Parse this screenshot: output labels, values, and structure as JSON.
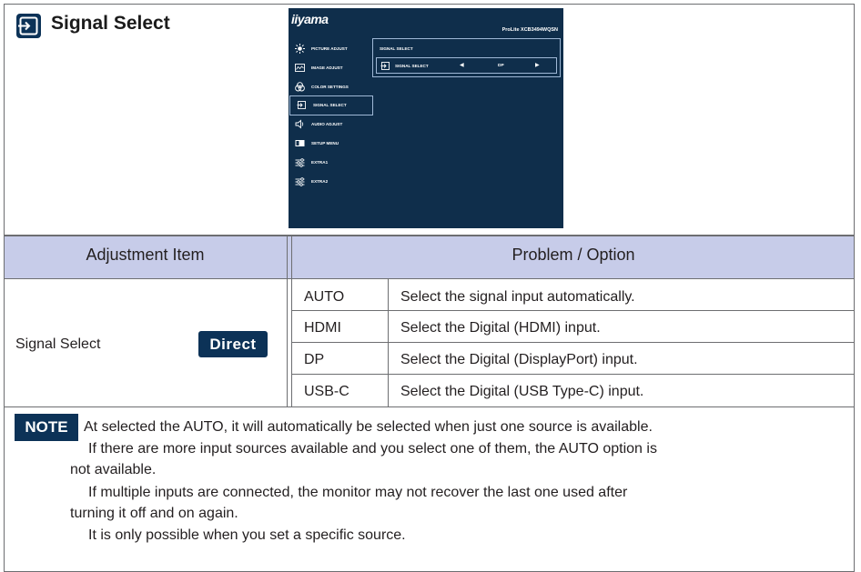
{
  "header": {
    "title": "Signal Select",
    "icon": "signal-input-icon"
  },
  "osd": {
    "logo": "iiyama",
    "model": "ProLite XCB3494WQSN",
    "menu": [
      {
        "label": "PICTURE ADJUST",
        "icon": "sun-icon",
        "selected": false
      },
      {
        "label": "IMAGE ADJUST",
        "icon": "image-adjust-icon",
        "selected": false
      },
      {
        "label": "COLOR SETTINGS",
        "icon": "color-settings-icon",
        "selected": false
      },
      {
        "label": "SIGNAL SELECT",
        "icon": "signal-input-icon",
        "selected": true
      },
      {
        "label": "AUDIO ADJUST",
        "icon": "speaker-icon",
        "selected": false
      },
      {
        "label": "SETUP MENU",
        "icon": "setup-menu-icon",
        "selected": false
      },
      {
        "label": "EXTRA1",
        "icon": "sliders-icon",
        "selected": false
      },
      {
        "label": "EXTRA2",
        "icon": "sliders-icon",
        "selected": false
      }
    ],
    "submenu": {
      "title": "SIGNAL SELECT",
      "row_label": "SIGNAL SELECT",
      "value": "DP",
      "left_arrow": "◀",
      "right_arrow": "▶"
    }
  },
  "table": {
    "header_item": "Adjustment Item",
    "header_option": "Problem / Option",
    "item_label": "Signal Select",
    "direct_badge": "Direct",
    "options": [
      {
        "key": "AUTO",
        "desc": "Select the signal input automatically."
      },
      {
        "key": "HDMI",
        "desc": "Select the Digital (HDMI) input."
      },
      {
        "key": "DP",
        "desc": "Select the Digital (DisplayPort) input."
      },
      {
        "key": "USB-C",
        "desc": "Select the Digital (USB Type-C) input."
      }
    ]
  },
  "note": {
    "badge": "NOTE",
    "lines": [
      "At selected the AUTO, it will automatically be selected when just one source is available.",
      "If there are more input sources available and you select one of them, the AUTO option is",
      "not available.",
      "If multiple inputs are connected, the monitor may not recover the last one used after",
      "turning it off and on again.",
      "It is only possible when you set a specific source."
    ]
  },
  "colors": {
    "navy": "#0c3257",
    "osd_bg": "#0f2e4b",
    "header_band": "#c7cce9",
    "rule": "#6d6e71"
  }
}
